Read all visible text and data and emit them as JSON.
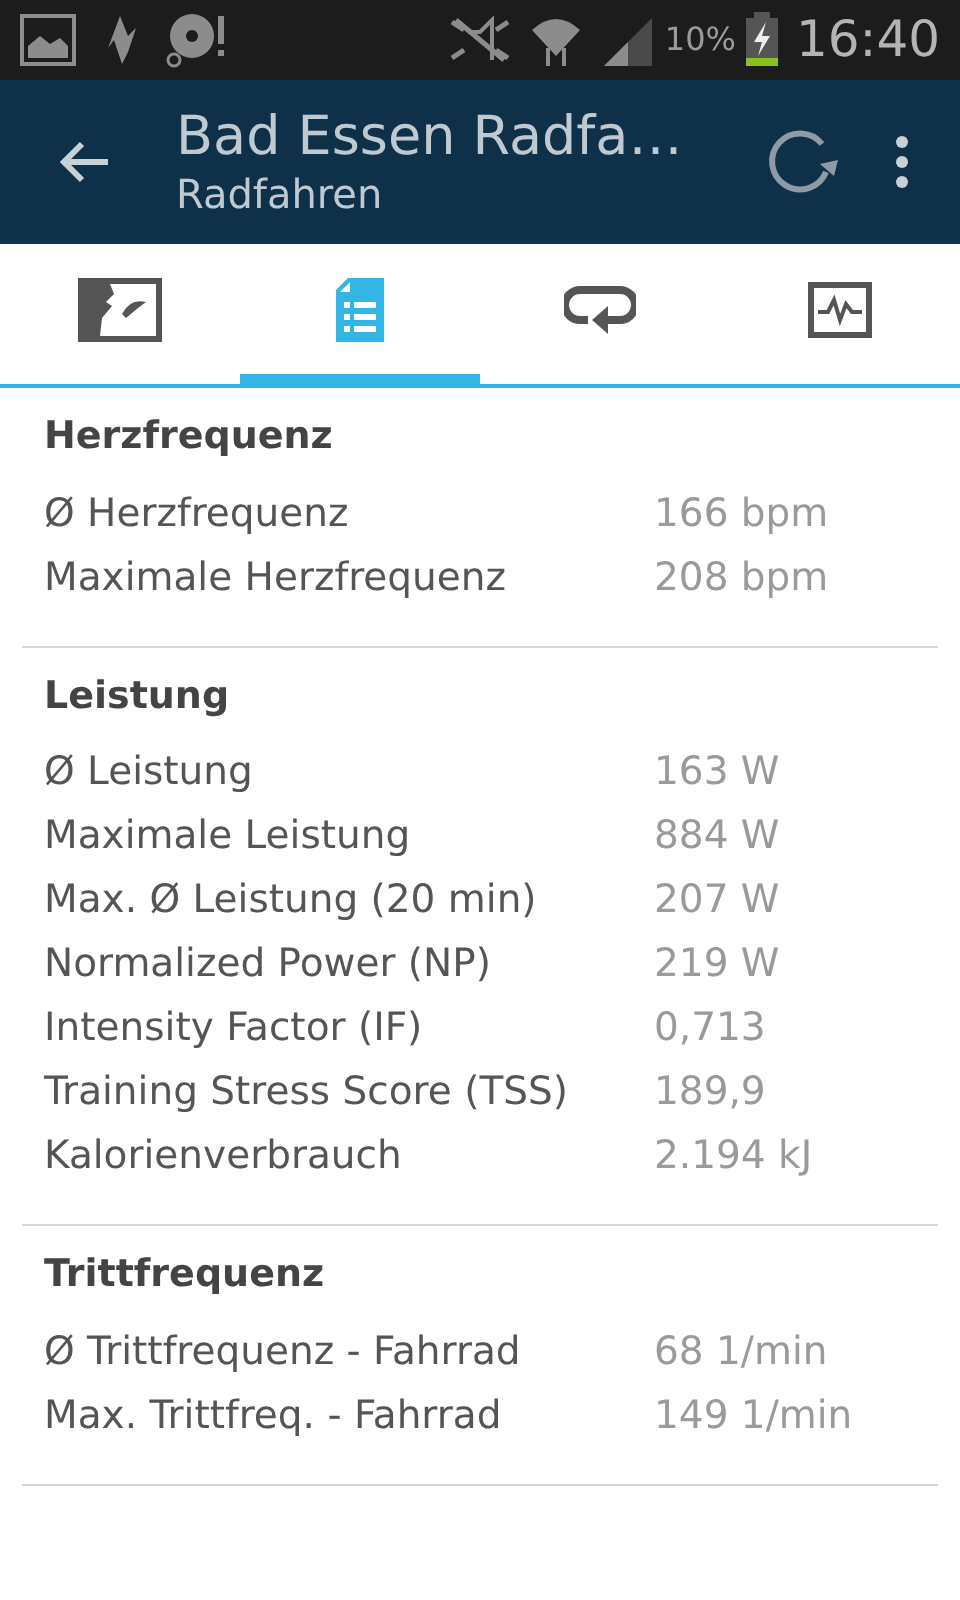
{
  "status_bar": {
    "battery": "10%",
    "time": "16:40"
  },
  "header": {
    "title": "Bad Essen Radfa…",
    "subtitle": "Radfahren"
  },
  "tabs": [
    {
      "selected": false
    },
    {
      "selected": true
    },
    {
      "selected": false
    },
    {
      "selected": false
    }
  ],
  "sections": [
    {
      "title": "Herzfrequenz",
      "rows": [
        {
          "label": "Ø Herzfrequenz",
          "value": "166 bpm"
        },
        {
          "label": "Maximale Herzfrequenz",
          "value": "208 bpm"
        }
      ]
    },
    {
      "title": "Leistung",
      "rows": [
        {
          "label": "Ø Leistung",
          "value": "163 W"
        },
        {
          "label": "Maximale Leistung",
          "value": "884 W"
        },
        {
          "label": "Max. Ø Leistung (20 min)",
          "value": "207 W"
        },
        {
          "label": "Normalized Power (NP)",
          "value": "219 W"
        },
        {
          "label": "Intensity Factor (IF)",
          "value": "0,713"
        },
        {
          "label": "Training Stress Score (TSS)",
          "value": "189,9"
        },
        {
          "label": "Kalorienverbrauch",
          "value": "2.194 kJ"
        }
      ]
    },
    {
      "title": "Trittfrequenz",
      "rows": [
        {
          "label": "Ø Trittfrequenz - Fahrrad",
          "value": "68 1/min"
        },
        {
          "label": "Max. Trittfreq. - Fahrrad",
          "value": "149 1/min"
        }
      ]
    }
  ]
}
